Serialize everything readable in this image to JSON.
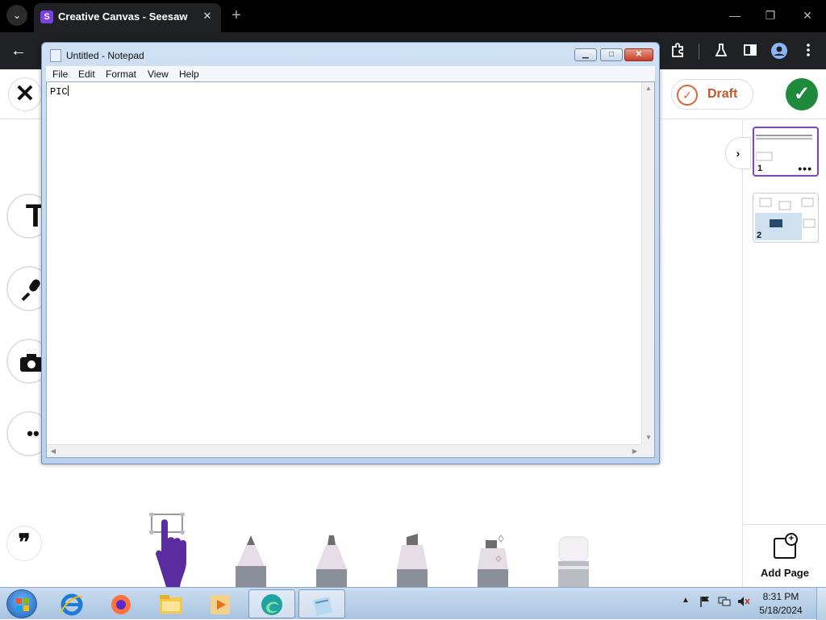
{
  "browser": {
    "tab_title": "Creative Canvas - Seesaw",
    "tab_favicon_letter": "S",
    "tab_dropdown_glyph": "⌄",
    "close_glyph": "✕",
    "new_tab_glyph": "+",
    "back_glyph": "←",
    "window_controls": {
      "minimize": "—",
      "restore": "❐",
      "close": "✕"
    }
  },
  "seesaw": {
    "close_glyph": "✕",
    "draft_label": "Draft",
    "draft_icon": "✓",
    "submit_icon": "✓",
    "tools": {
      "text_glyph": "T",
      "more_glyph": "••",
      "quote_glyph": "❞"
    },
    "pages": [
      {
        "number": "1",
        "more": "•••"
      },
      {
        "number": "2"
      }
    ],
    "panel_toggle_glyph": "›",
    "add_page_label": "Add Page",
    "add_page_plus": "+"
  },
  "notepad": {
    "title": "Untitled - Notepad",
    "menu": [
      "File",
      "Edit",
      "Format",
      "View",
      "Help"
    ],
    "content": "PIC",
    "controls": {
      "minimize": "▁",
      "maximize": "□",
      "close": "✕"
    }
  },
  "taskbar": {
    "clock_time": "8:31 PM",
    "clock_date": "5/18/2024",
    "tray_arrow": "▲"
  },
  "colors": {
    "seesaw_purple": "#7b3fe4",
    "draft_orange": "#c0592d",
    "submit_green": "#1f8a3b"
  }
}
